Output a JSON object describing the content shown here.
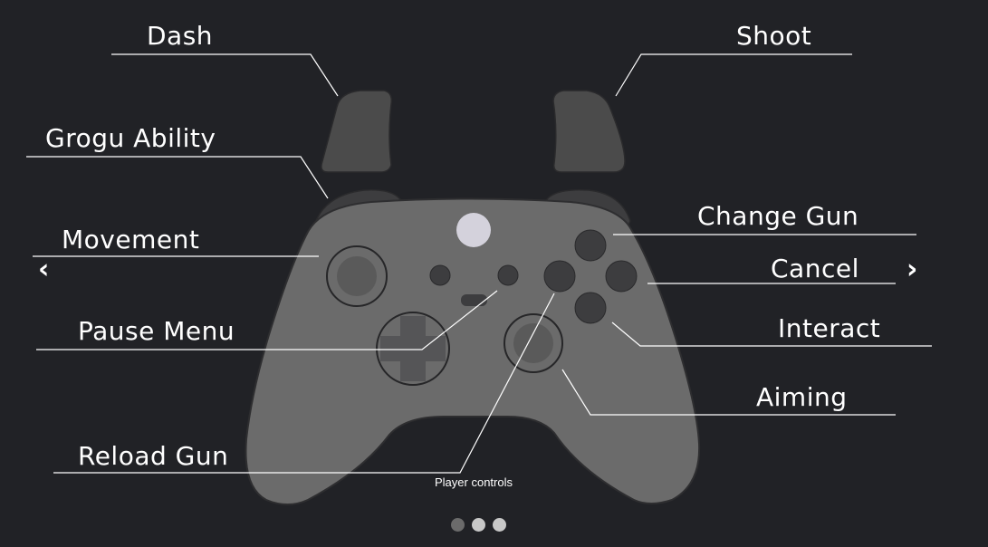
{
  "carousel": {
    "caption": "Player controls",
    "prev_icon": "chevron-left",
    "prev_symbol": "‹",
    "next_icon": "chevron-right",
    "next_symbol": "›",
    "indicators": {
      "count": 3,
      "active_index": 0
    }
  },
  "labels": {
    "dash": "Dash",
    "shoot": "Shoot",
    "grogu_ability": "Grogu Ability",
    "movement": "Movement",
    "pause_menu": "Pause Menu",
    "reload_gun": "Reload Gun",
    "change_gun": "Change Gun",
    "cancel": "Cancel",
    "interact": "Interact",
    "aiming": "Aiming"
  },
  "colors": {
    "background": "#212226",
    "controller_body": "#6b6b6b",
    "controller_dark": "#3d3d3f",
    "trigger": "#4b4b4b",
    "guide_button": "#d4d2dc",
    "line": "#ffffff",
    "dot_active": "#6b6b6b",
    "dot_inactive": "#c8c8c8"
  }
}
